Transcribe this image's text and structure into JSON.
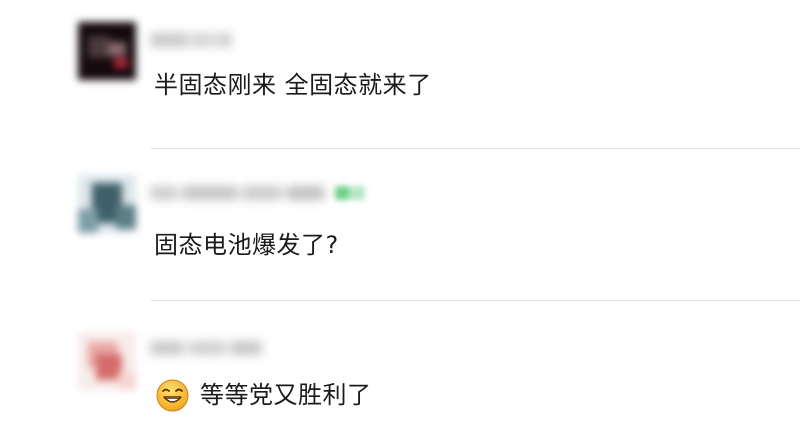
{
  "comments": [
    {
      "text": "半固态刚来 全固态就来了",
      "avatar_colors": [
        "#1a0f12",
        "#3a2a2e",
        "#8a6a6e",
        "#c23a4a"
      ]
    },
    {
      "text": "固态电池爆发了?",
      "avatar_colors": [
        "#d8e4ea",
        "#3f6068",
        "#7c9ea6",
        "#2c4a52"
      ],
      "badge_color": "#6fd08a"
    },
    {
      "text": "等等党又胜利了",
      "emoji": "grinning-face-emoji",
      "avatar_colors": [
        "#f3d6d2",
        "#e08a86",
        "#c55a5a",
        "#f7ecea"
      ]
    }
  ]
}
